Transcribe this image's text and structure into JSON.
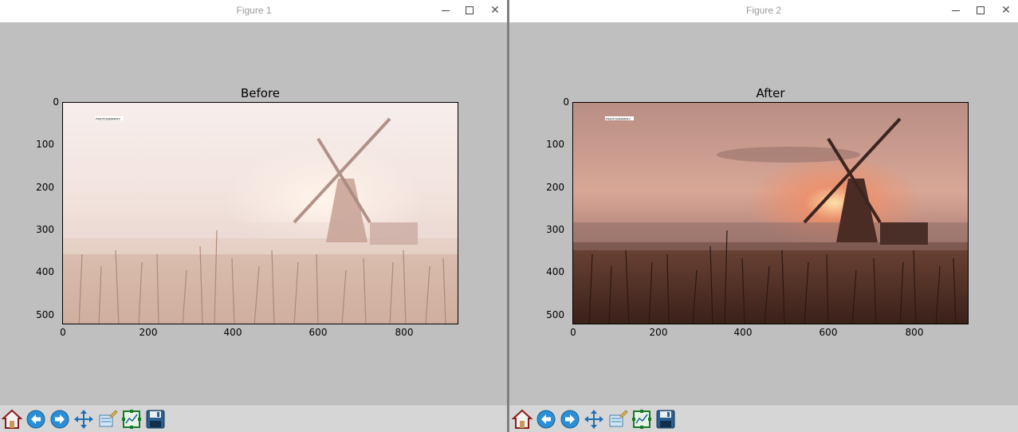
{
  "windows": [
    {
      "title": "Figure 1",
      "axes_title": "Before",
      "yticks": [
        "0",
        "100",
        "200",
        "300",
        "400",
        "500"
      ],
      "xticks": [
        "0",
        "200",
        "400",
        "600",
        "800"
      ],
      "image_overlay_text": "PHOTOGRAPHY"
    },
    {
      "title": "Figure 2",
      "axes_title": "After",
      "yticks": [
        "0",
        "100",
        "200",
        "300",
        "400",
        "500"
      ],
      "xticks": [
        "0",
        "200",
        "400",
        "600",
        "800"
      ],
      "image_overlay_text": "PHOTOGRAPHY"
    }
  ],
  "toolbar": {
    "icons": [
      "home-icon",
      "back-arrow-icon",
      "forward-arrow-icon",
      "pan-icon",
      "configure-subplots-icon",
      "zoom-to-rect-icon",
      "save-icon"
    ]
  },
  "colors": {
    "figure_background": "#bfbfbf",
    "toolbar_background": "#d6d6d6",
    "before_sky": "#f4e6e2",
    "after_sky": "#d9a795"
  }
}
